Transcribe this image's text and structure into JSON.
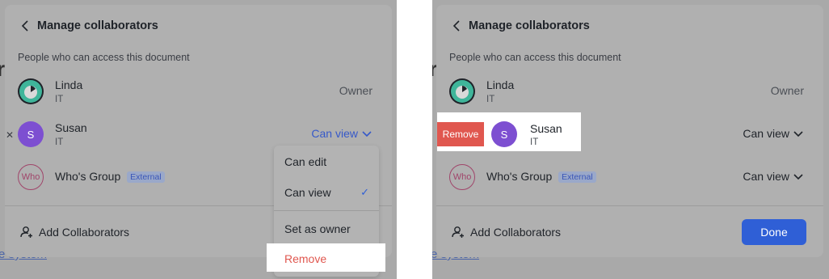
{
  "dialog": {
    "title": "Manage collaborators",
    "subtitle": "People who can access this document",
    "add_collaborators": "Add Collaborators",
    "done": "Done"
  },
  "collaborators": [
    {
      "name": "Linda",
      "dept": "IT",
      "role": "Owner"
    },
    {
      "name": "Susan",
      "dept": "IT",
      "initial": "S",
      "role": "Can view"
    },
    {
      "name": "Who's Group",
      "initial": "Who",
      "tag": "External",
      "role": "Can view"
    }
  ],
  "dropdown": {
    "items": [
      "Can edit",
      "Can view",
      "Set as owner",
      "Remove"
    ],
    "checked": "Can view",
    "check_icon": "checkmark-icon"
  },
  "swipe": {
    "remove_label": "Remove"
  },
  "background": {
    "link_text": "e system",
    "letter": "r"
  },
  "colors": {
    "accent": "#2f5fd6",
    "danger": "#e0574f",
    "susan_avatar": "#7d4fd1",
    "group_avatar": "#a0456a"
  }
}
